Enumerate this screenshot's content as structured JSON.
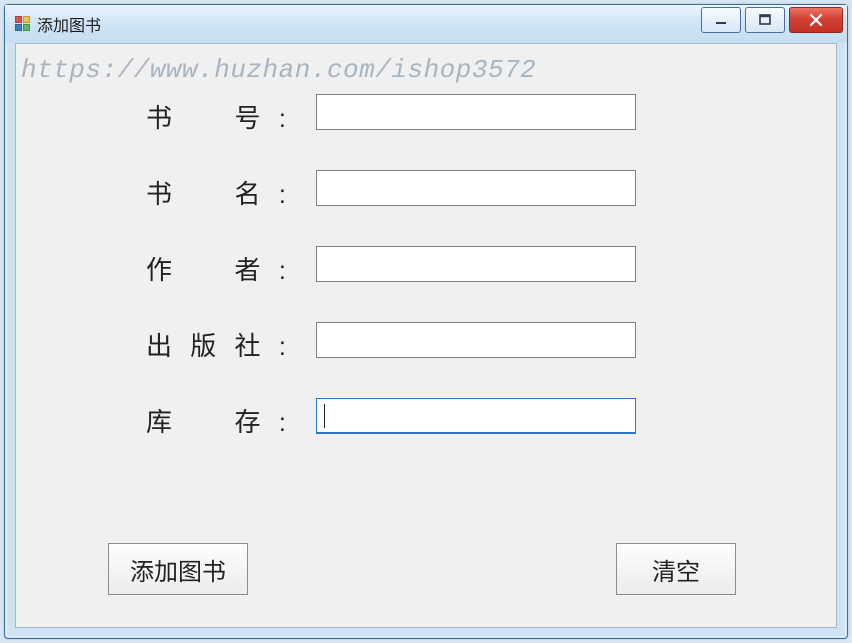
{
  "window": {
    "title": "添加图书"
  },
  "watermark": "https://www.huzhan.com/ishop3572",
  "form": {
    "fields": [
      {
        "label": "书　号:",
        "value": "",
        "focused": false
      },
      {
        "label": "书　名:",
        "value": "",
        "focused": false
      },
      {
        "label": "作　者:",
        "value": "",
        "focused": false
      },
      {
        "label": "出版社:",
        "value": "",
        "focused": false
      },
      {
        "label": "库　存:",
        "value": "",
        "focused": true
      }
    ]
  },
  "buttons": {
    "add": "添加图书",
    "clear": "清空"
  }
}
